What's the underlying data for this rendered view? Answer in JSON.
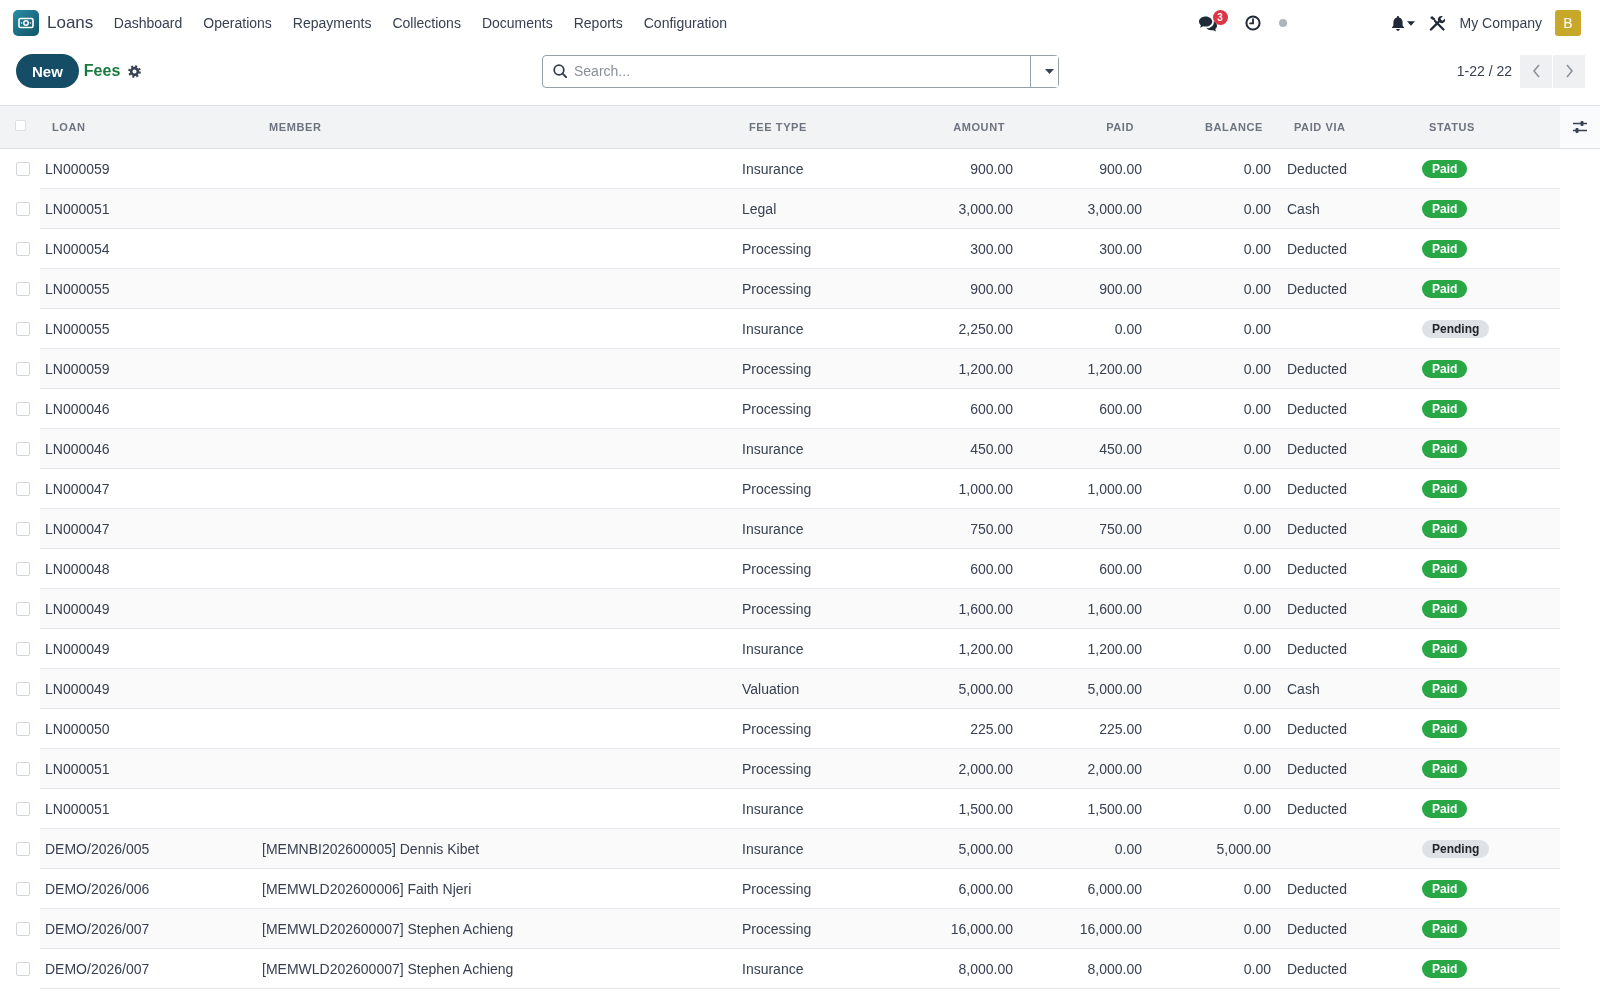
{
  "navbar": {
    "app_name": "Loans",
    "menu": [
      "Dashboard",
      "Operations",
      "Repayments",
      "Collections",
      "Documents",
      "Reports",
      "Configuration"
    ],
    "systray": {
      "messages_count": "3",
      "company": "My Company",
      "avatar_letter": "B"
    }
  },
  "control_panel": {
    "new_button": "New",
    "breadcrumb": "Fees",
    "search": {
      "placeholder": "Search..."
    },
    "pager": "1-22 / 22"
  },
  "table": {
    "select_all": {
      "checked": false
    },
    "columns": [
      {
        "label": "LOAN",
        "kind": "text"
      },
      {
        "label": "MEMBER",
        "kind": "text"
      },
      {
        "label": "FEE TYPE",
        "kind": "text"
      },
      {
        "label": "AMOUNT",
        "kind": "number"
      },
      {
        "label": "PAID",
        "kind": "number"
      },
      {
        "label": "BALANCE",
        "kind": "number"
      },
      {
        "label": "PAID VIA",
        "kind": "text"
      },
      {
        "label": "STATUS",
        "kind": "status"
      }
    ],
    "rows": [
      {
        "checked": false,
        "loan": "LN000059",
        "fee_type": "Insurance",
        "amount": "900.00",
        "paid": "900.00",
        "balance": "0.00",
        "paid_via": "Deducted",
        "status": {
          "label": "Paid",
          "color": "#28a745"
        }
      },
      {
        "checked": false,
        "loan": "LN000051",
        "fee_type": "Legal",
        "amount": "3,000.00",
        "paid": "3,000.00",
        "balance": "0.00",
        "paid_via": "Cash",
        "status": {
          "label": "Paid",
          "color": "#28a745"
        }
      },
      {
        "checked": false,
        "loan": "LN000054",
        "fee_type": "Processing",
        "amount": "300.00",
        "paid": "300.00",
        "balance": "0.00",
        "paid_via": "Deducted",
        "status": {
          "label": "Paid",
          "color": "#28a745"
        }
      },
      {
        "checked": false,
        "loan": "LN000055",
        "fee_type": "Processing",
        "amount": "900.00",
        "paid": "900.00",
        "balance": "0.00",
        "paid_via": "Deducted",
        "status": {
          "label": "Paid",
          "color": "#28a745"
        }
      },
      {
        "checked": false,
        "loan": "LN000055",
        "fee_type": "Insurance",
        "amount": "2,250.00",
        "paid": "0.00",
        "balance": "0.00",
        "status": {
          "label": "Pending",
          "color": "#dee2e6"
        }
      },
      {
        "checked": false,
        "loan": "LN000059",
        "fee_type": "Processing",
        "amount": "1,200.00",
        "paid": "1,200.00",
        "balance": "0.00",
        "paid_via": "Deducted",
        "status": {
          "label": "Paid",
          "color": "#28a745"
        }
      },
      {
        "checked": false,
        "loan": "LN000046",
        "fee_type": "Processing",
        "amount": "600.00",
        "paid": "600.00",
        "balance": "0.00",
        "paid_via": "Deducted",
        "status": {
          "label": "Paid",
          "color": "#28a745"
        }
      },
      {
        "checked": false,
        "loan": "LN000046",
        "fee_type": "Insurance",
        "amount": "450.00",
        "paid": "450.00",
        "balance": "0.00",
        "paid_via": "Deducted",
        "status": {
          "label": "Paid",
          "color": "#28a745"
        }
      },
      {
        "checked": false,
        "loan": "LN000047",
        "fee_type": "Processing",
        "amount": "1,000.00",
        "paid": "1,000.00",
        "balance": "0.00",
        "paid_via": "Deducted",
        "status": {
          "label": "Paid",
          "color": "#28a745"
        }
      },
      {
        "checked": false,
        "loan": "LN000047",
        "fee_type": "Insurance",
        "amount": "750.00",
        "paid": "750.00",
        "balance": "0.00",
        "paid_via": "Deducted",
        "status": {
          "label": "Paid",
          "color": "#28a745"
        }
      },
      {
        "checked": false,
        "loan": "LN000048",
        "fee_type": "Processing",
        "amount": "600.00",
        "paid": "600.00",
        "balance": "0.00",
        "paid_via": "Deducted",
        "status": {
          "label": "Paid",
          "color": "#28a745"
        }
      },
      {
        "checked": false,
        "loan": "LN000049",
        "fee_type": "Processing",
        "amount": "1,600.00",
        "paid": "1,600.00",
        "balance": "0.00",
        "paid_via": "Deducted",
        "status": {
          "label": "Paid",
          "color": "#28a745"
        }
      },
      {
        "checked": false,
        "loan": "LN000049",
        "fee_type": "Insurance",
        "amount": "1,200.00",
        "paid": "1,200.00",
        "balance": "0.00",
        "paid_via": "Deducted",
        "status": {
          "label": "Paid",
          "color": "#28a745"
        }
      },
      {
        "checked": false,
        "loan": "LN000049",
        "fee_type": "Valuation",
        "amount": "5,000.00",
        "paid": "5,000.00",
        "balance": "0.00",
        "paid_via": "Cash",
        "status": {
          "label": "Paid",
          "color": "#28a745"
        }
      },
      {
        "checked": false,
        "loan": "LN000050",
        "fee_type": "Processing",
        "amount": "225.00",
        "paid": "225.00",
        "balance": "0.00",
        "paid_via": "Deducted",
        "status": {
          "label": "Paid",
          "color": "#28a745"
        }
      },
      {
        "checked": false,
        "loan": "LN000051",
        "fee_type": "Processing",
        "amount": "2,000.00",
        "paid": "2,000.00",
        "balance": "0.00",
        "paid_via": "Deducted",
        "status": {
          "label": "Paid",
          "color": "#28a745"
        }
      },
      {
        "checked": false,
        "loan": "LN000051",
        "fee_type": "Insurance",
        "amount": "1,500.00",
        "paid": "1,500.00",
        "balance": "0.00",
        "paid_via": "Deducted",
        "status": {
          "label": "Paid",
          "color": "#28a745"
        }
      },
      {
        "checked": false,
        "loan": "DEMO/2026/005",
        "member": "[MEMNBI202600005] Dennis Kibet",
        "fee_type": "Insurance",
        "amount": "5,000.00",
        "paid": "0.00",
        "balance": "5,000.00",
        "status": {
          "label": "Pending",
          "color": "#dee2e6"
        }
      },
      {
        "checked": false,
        "loan": "DEMO/2026/006",
        "member": "[MEMWLD202600006] Faith Njeri",
        "fee_type": "Processing",
        "amount": "6,000.00",
        "paid": "6,000.00",
        "balance": "0.00",
        "paid_via": "Deducted",
        "status": {
          "label": "Paid",
          "color": "#28a745"
        }
      },
      {
        "checked": false,
        "loan": "DEMO/2026/007",
        "member": "[MEMWLD202600007] Stephen Achieng",
        "fee_type": "Processing",
        "amount": "16,000.00",
        "paid": "16,000.00",
        "balance": "0.00",
        "paid_via": "Deducted",
        "status": {
          "label": "Paid",
          "color": "#28a745"
        }
      },
      {
        "checked": false,
        "loan": "DEMO/2026/007",
        "member": "[MEMWLD202600007] Stephen Achieng",
        "fee_type": "Insurance",
        "amount": "8,000.00",
        "paid": "8,000.00",
        "balance": "0.00",
        "paid_via": "Deducted",
        "status": {
          "label": "Paid",
          "color": "#28a745"
        }
      }
    ]
  }
}
